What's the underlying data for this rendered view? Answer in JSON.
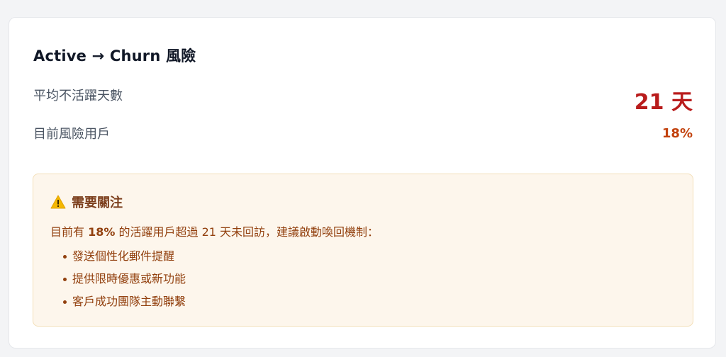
{
  "card": {
    "title": "Active → Churn 風險",
    "metrics": [
      {
        "label": "平均不活躍天數",
        "value": "21 天"
      },
      {
        "label": "目前風險用戶",
        "value": "18%"
      }
    ]
  },
  "alert": {
    "icon": "warning-icon",
    "title": "需要關注",
    "text_prefix": "目前有 ",
    "text_highlight": "18%",
    "text_suffix": " 的活躍用戶超過 21 天未回訪，建議啟動喚回機制：",
    "items": [
      "發送個性化郵件提醒",
      "提供限時優惠或新功能",
      "客戶成功團隊主動聯繫"
    ]
  },
  "colors": {
    "danger": "#b91c1c",
    "warning": "#c2410c",
    "alert_bg": "#fdf6ec",
    "alert_text": "#92400e"
  }
}
